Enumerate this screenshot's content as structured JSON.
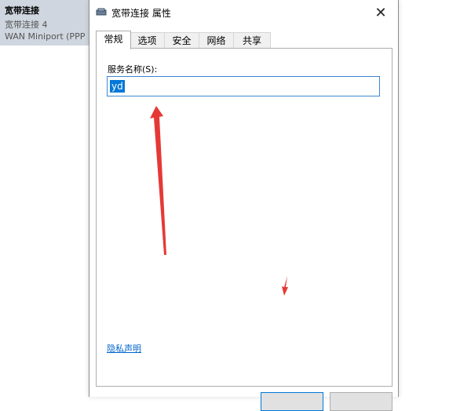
{
  "background": {
    "connection_name": "宽带连接",
    "connection_subtitle": "宽带连接  4",
    "device": "WAN Miniport (PPP"
  },
  "dialog": {
    "title": "宽带连接 属性",
    "close_icon": "close-icon",
    "tabs": [
      {
        "label": "常规",
        "active": true
      },
      {
        "label": "选项",
        "active": false
      },
      {
        "label": "安全",
        "active": false
      },
      {
        "label": "网络",
        "active": false
      },
      {
        "label": "共享",
        "active": false
      }
    ],
    "general": {
      "service_name_label": "服务名称(S):",
      "service_name_value": "yd",
      "privacy_link": "隐私声明"
    }
  },
  "annotations": {
    "arrow_color": "#e53935"
  }
}
